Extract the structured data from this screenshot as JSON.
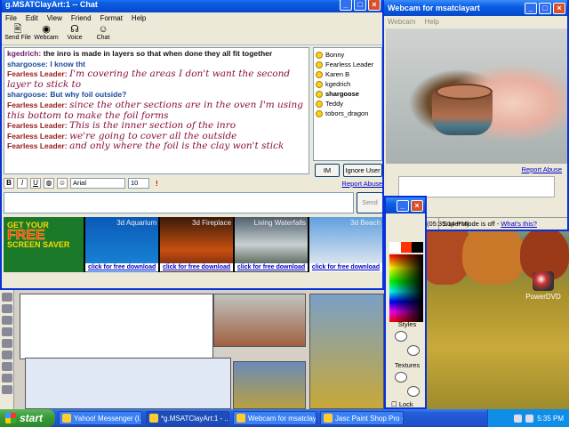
{
  "chat": {
    "title": "g.MSATClayArt:1 -- Chat",
    "menu": [
      "File",
      "Edit",
      "View",
      "Friend",
      "Format",
      "Help"
    ],
    "toolbar": [
      {
        "label": "Send File",
        "icon": "send-file-icon"
      },
      {
        "label": "Webcam",
        "icon": "webcam-icon"
      },
      {
        "label": "Voice",
        "icon": "voice-icon"
      },
      {
        "label": "Chat",
        "icon": "chat-icon"
      }
    ],
    "messages": [
      {
        "name": "kgedrich:",
        "text": "the inro is made in layers so that when done they all fit together",
        "style": "kg"
      },
      {
        "name": "shargoose:",
        "text": "I know tht",
        "style": "sg"
      },
      {
        "name": "Fearless Leader:",
        "text": "I'm covering the areas I don't want the second layer to stick to",
        "style": "fl"
      },
      {
        "name": "shargoose:",
        "text": "But why foil outside?",
        "style": "sg"
      },
      {
        "name": "Fearless Leader:",
        "text": "since the other sections are in the oven I'm using this bottom to make the foil forms",
        "style": "fl"
      },
      {
        "name": "Fearless Leader:",
        "text": "This is the inner section of the inro",
        "style": "fl"
      },
      {
        "name": "Fearless Leader:",
        "text": "we're going to cover all the outside",
        "style": "fl"
      },
      {
        "name": "Fearless Leader:",
        "text": "and only where the foil is the clay won't stick",
        "style": "fl"
      }
    ],
    "users": [
      {
        "name": "Bonny",
        "bold": false
      },
      {
        "name": "Fearless Leader",
        "bold": false
      },
      {
        "name": "Karen B",
        "bold": false
      },
      {
        "name": "kgedrich",
        "bold": false
      },
      {
        "name": "shargoose",
        "bold": true
      },
      {
        "name": "Teddy",
        "bold": false
      },
      {
        "name": "tobors_dragon",
        "bold": false
      }
    ],
    "im_button": "IM",
    "ignore_button": "Ignore User",
    "format": {
      "font": "Arial",
      "size": "10",
      "bold": "B",
      "italic": "I",
      "underline": "U"
    },
    "report_abuse": "Report Abuse",
    "send_button": "Send",
    "ads": [
      {
        "title": "GET YOUR",
        "big": "FREE",
        "sub": "SCREEN SAVER"
      },
      {
        "title": "3d Aquarium",
        "download": "click for free download"
      },
      {
        "title": "3d Fireplace",
        "download": "click for free download"
      },
      {
        "title": "Living Waterfalls",
        "download": "click for free download"
      },
      {
        "title": "3d Beach",
        "download": "click for free download"
      }
    ]
  },
  "webcam": {
    "title": "Webcam for msatclayart",
    "menu": [
      "Webcam",
      "Help"
    ],
    "report_abuse": "Report Abuse",
    "status_time": "(05:35:14 PM)",
    "status_msg": "Super mode is off -",
    "status_link": "What's this?"
  },
  "palette": {
    "styles_label": "Styles",
    "textures_label": "Textures",
    "lock_label": "Lock"
  },
  "desktop": {
    "icon_label": "PowerDVD"
  },
  "taskbar": {
    "start_label": "start",
    "tasks": [
      {
        "label": "Yahoo! Messenger (I...",
        "active": false
      },
      {
        "label": "*g.MSATClayArt:1 - ...",
        "active": true
      },
      {
        "label": "Webcam for msatclay...",
        "active": false
      },
      {
        "label": "Jasc Paint Shop Pro - ...",
        "active": false
      }
    ],
    "clock": "5:35 PM"
  }
}
